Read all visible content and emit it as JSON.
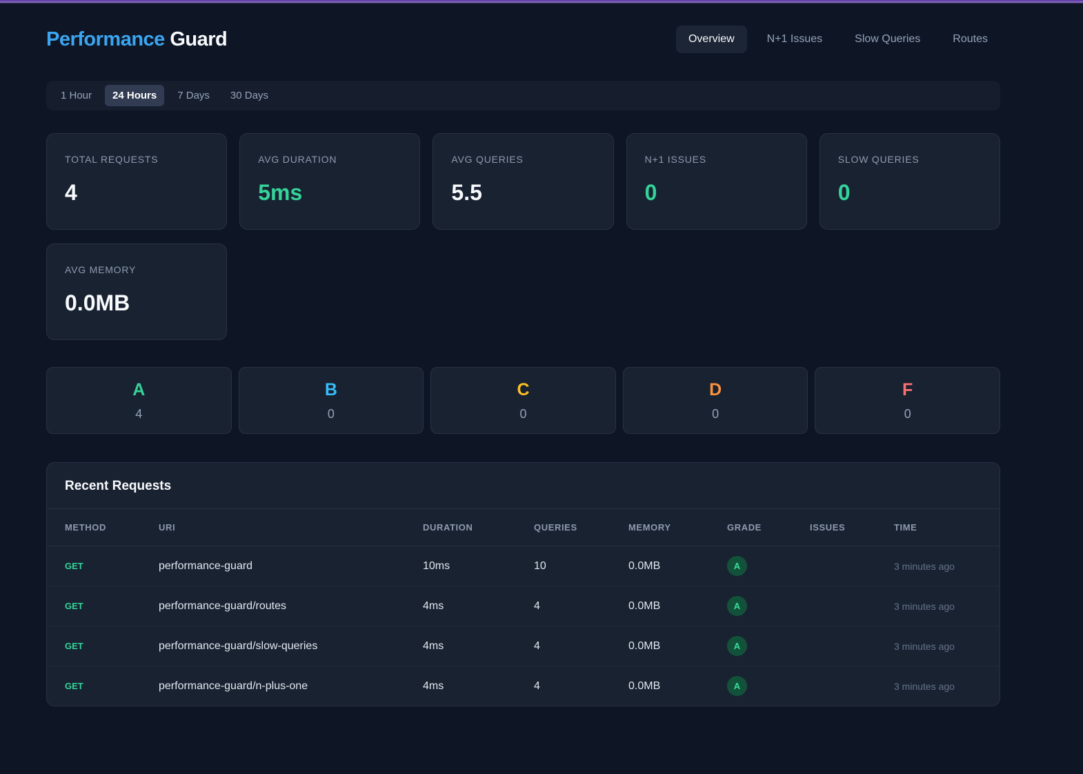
{
  "accent_color": "#8b5cf6",
  "header": {
    "title_brand": "Performance",
    "title_rest": "Guard",
    "brand_color": "#3ba5f0",
    "nav": [
      {
        "label": "Overview",
        "active": true
      },
      {
        "label": "N+1 Issues",
        "active": false
      },
      {
        "label": "Slow Queries",
        "active": false
      },
      {
        "label": "Routes",
        "active": false
      }
    ]
  },
  "time_range": {
    "options": [
      {
        "label": "1 Hour",
        "active": false
      },
      {
        "label": "24 Hours",
        "active": true
      },
      {
        "label": "7 Days",
        "active": false
      },
      {
        "label": "30 Days",
        "active": false
      }
    ]
  },
  "stats": [
    {
      "label": "TOTAL REQUESTS",
      "value": "4",
      "color": "white"
    },
    {
      "label": "AVG DURATION",
      "value": "5ms",
      "color": "green"
    },
    {
      "label": "AVG QUERIES",
      "value": "5.5",
      "color": "white"
    },
    {
      "label": "N+1 ISSUES",
      "value": "0",
      "color": "green"
    },
    {
      "label": "SLOW QUERIES",
      "value": "0",
      "color": "green"
    },
    {
      "label": "AVG MEMORY",
      "value": "0.0MB",
      "color": "white"
    }
  ],
  "grades": [
    {
      "letter": "A",
      "count": "4",
      "color": "#34d399"
    },
    {
      "letter": "B",
      "count": "0",
      "color": "#38bdf8"
    },
    {
      "letter": "C",
      "count": "0",
      "color": "#fbbf24"
    },
    {
      "letter": "D",
      "count": "0",
      "color": "#fb923c"
    },
    {
      "letter": "F",
      "count": "0",
      "color": "#f87171"
    }
  ],
  "recent_requests": {
    "title": "Recent Requests",
    "columns": [
      "METHOD",
      "URI",
      "DURATION",
      "QUERIES",
      "MEMORY",
      "GRADE",
      "ISSUES",
      "TIME"
    ],
    "rows": [
      {
        "method": "GET",
        "uri": "performance-guard",
        "duration": "10ms",
        "queries": "10",
        "memory": "0.0MB",
        "grade": "A",
        "issues": "",
        "time": "3 minutes ago"
      },
      {
        "method": "GET",
        "uri": "performance-guard/routes",
        "duration": "4ms",
        "queries": "4",
        "memory": "0.0MB",
        "grade": "A",
        "issues": "",
        "time": "3 minutes ago"
      },
      {
        "method": "GET",
        "uri": "performance-guard/slow-queries",
        "duration": "4ms",
        "queries": "4",
        "memory": "0.0MB",
        "grade": "A",
        "issues": "",
        "time": "3 minutes ago"
      },
      {
        "method": "GET",
        "uri": "performance-guard/n-plus-one",
        "duration": "4ms",
        "queries": "4",
        "memory": "0.0MB",
        "grade": "A",
        "issues": "",
        "time": "3 minutes ago"
      }
    ]
  }
}
